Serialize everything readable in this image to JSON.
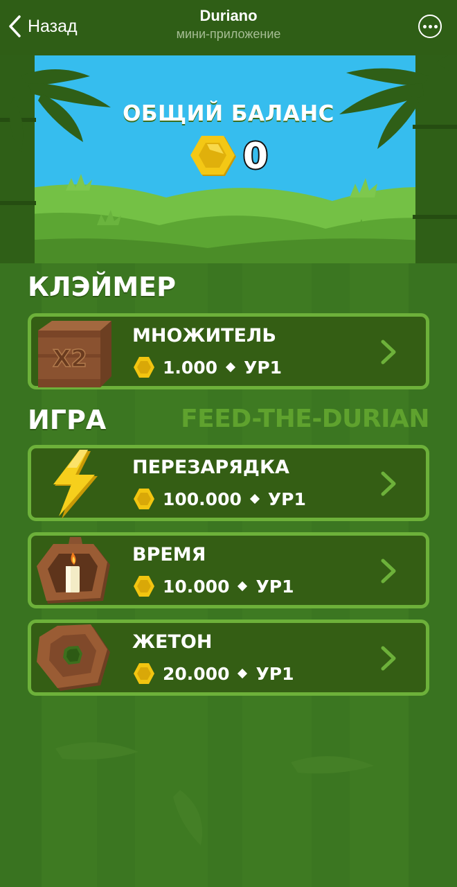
{
  "header": {
    "back_label": "Назад",
    "title": "Duriano",
    "subtitle": "мини-приложение",
    "back_icon": "chevron-left-icon",
    "more_icon": "more-horizontal-icon"
  },
  "balance": {
    "label": "ОБЩИЙ БАЛАНС",
    "value": "0",
    "coin_icon": "coin-icon"
  },
  "claimer": {
    "title": "КЛЭЙМЕР",
    "items": [
      {
        "title": "МНОЖИТЕЛЬ",
        "price": "1.000",
        "level": "УР1",
        "icon": "x2-crate-icon",
        "icon_text": "X2"
      }
    ]
  },
  "game": {
    "title": "ИГРА",
    "name": "FEED-THE-DURIAN",
    "items": [
      {
        "title": "ПЕРЕЗАРЯДКА",
        "price": "100.000",
        "level": "УР1",
        "icon": "lightning-icon"
      },
      {
        "title": "ВРЕМЯ",
        "price": "10.000",
        "level": "УР1",
        "icon": "candle-icon"
      },
      {
        "title": "ЖЕТОН",
        "price": "20.000",
        "level": "УР1",
        "icon": "token-icon"
      }
    ]
  },
  "colors": {
    "header_bg": "#2f5e16",
    "card_bg": "#345e14",
    "card_border": "#6db13a",
    "accent_green": "#5fa22e",
    "coin": "#f2c510",
    "sky": "#38bdec"
  }
}
